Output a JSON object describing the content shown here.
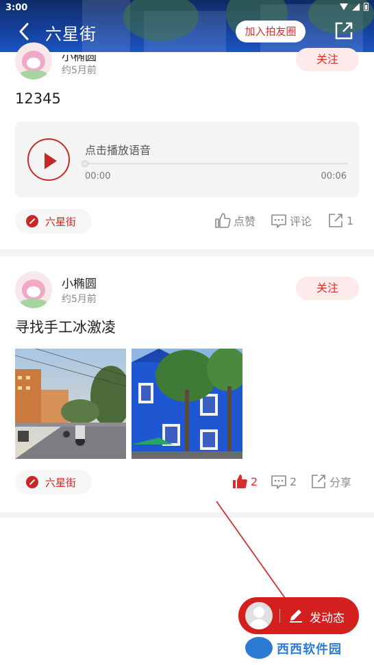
{
  "status_bar": {
    "time": "3:00"
  },
  "header": {
    "title": "六星街",
    "join_label": "加入拍友圈"
  },
  "posts": [
    {
      "user": "小椭圆",
      "time": "约5月前",
      "follow_label": "关注",
      "text": "12345",
      "audio": {
        "label": "点击播放语音",
        "current": "00:00",
        "duration": "00:06",
        "progress": 0
      },
      "tag": "六星街",
      "actions": {
        "like": "点赞",
        "comment": "评论",
        "share": "1"
      }
    },
    {
      "user": "小椭圆",
      "time": "约5月前",
      "follow_label": "关注",
      "text": "寻找手工冰激凌",
      "images": [
        "street-photo",
        "blue-building-photo"
      ],
      "tag": "六星街",
      "actions": {
        "like": "2",
        "comment": "2",
        "share": "分享"
      }
    }
  ],
  "fab": {
    "label": "发动态"
  },
  "watermark": {
    "text": "西西软件园"
  },
  "colors": {
    "accent": "#d32f2f",
    "header": "#15409a"
  }
}
